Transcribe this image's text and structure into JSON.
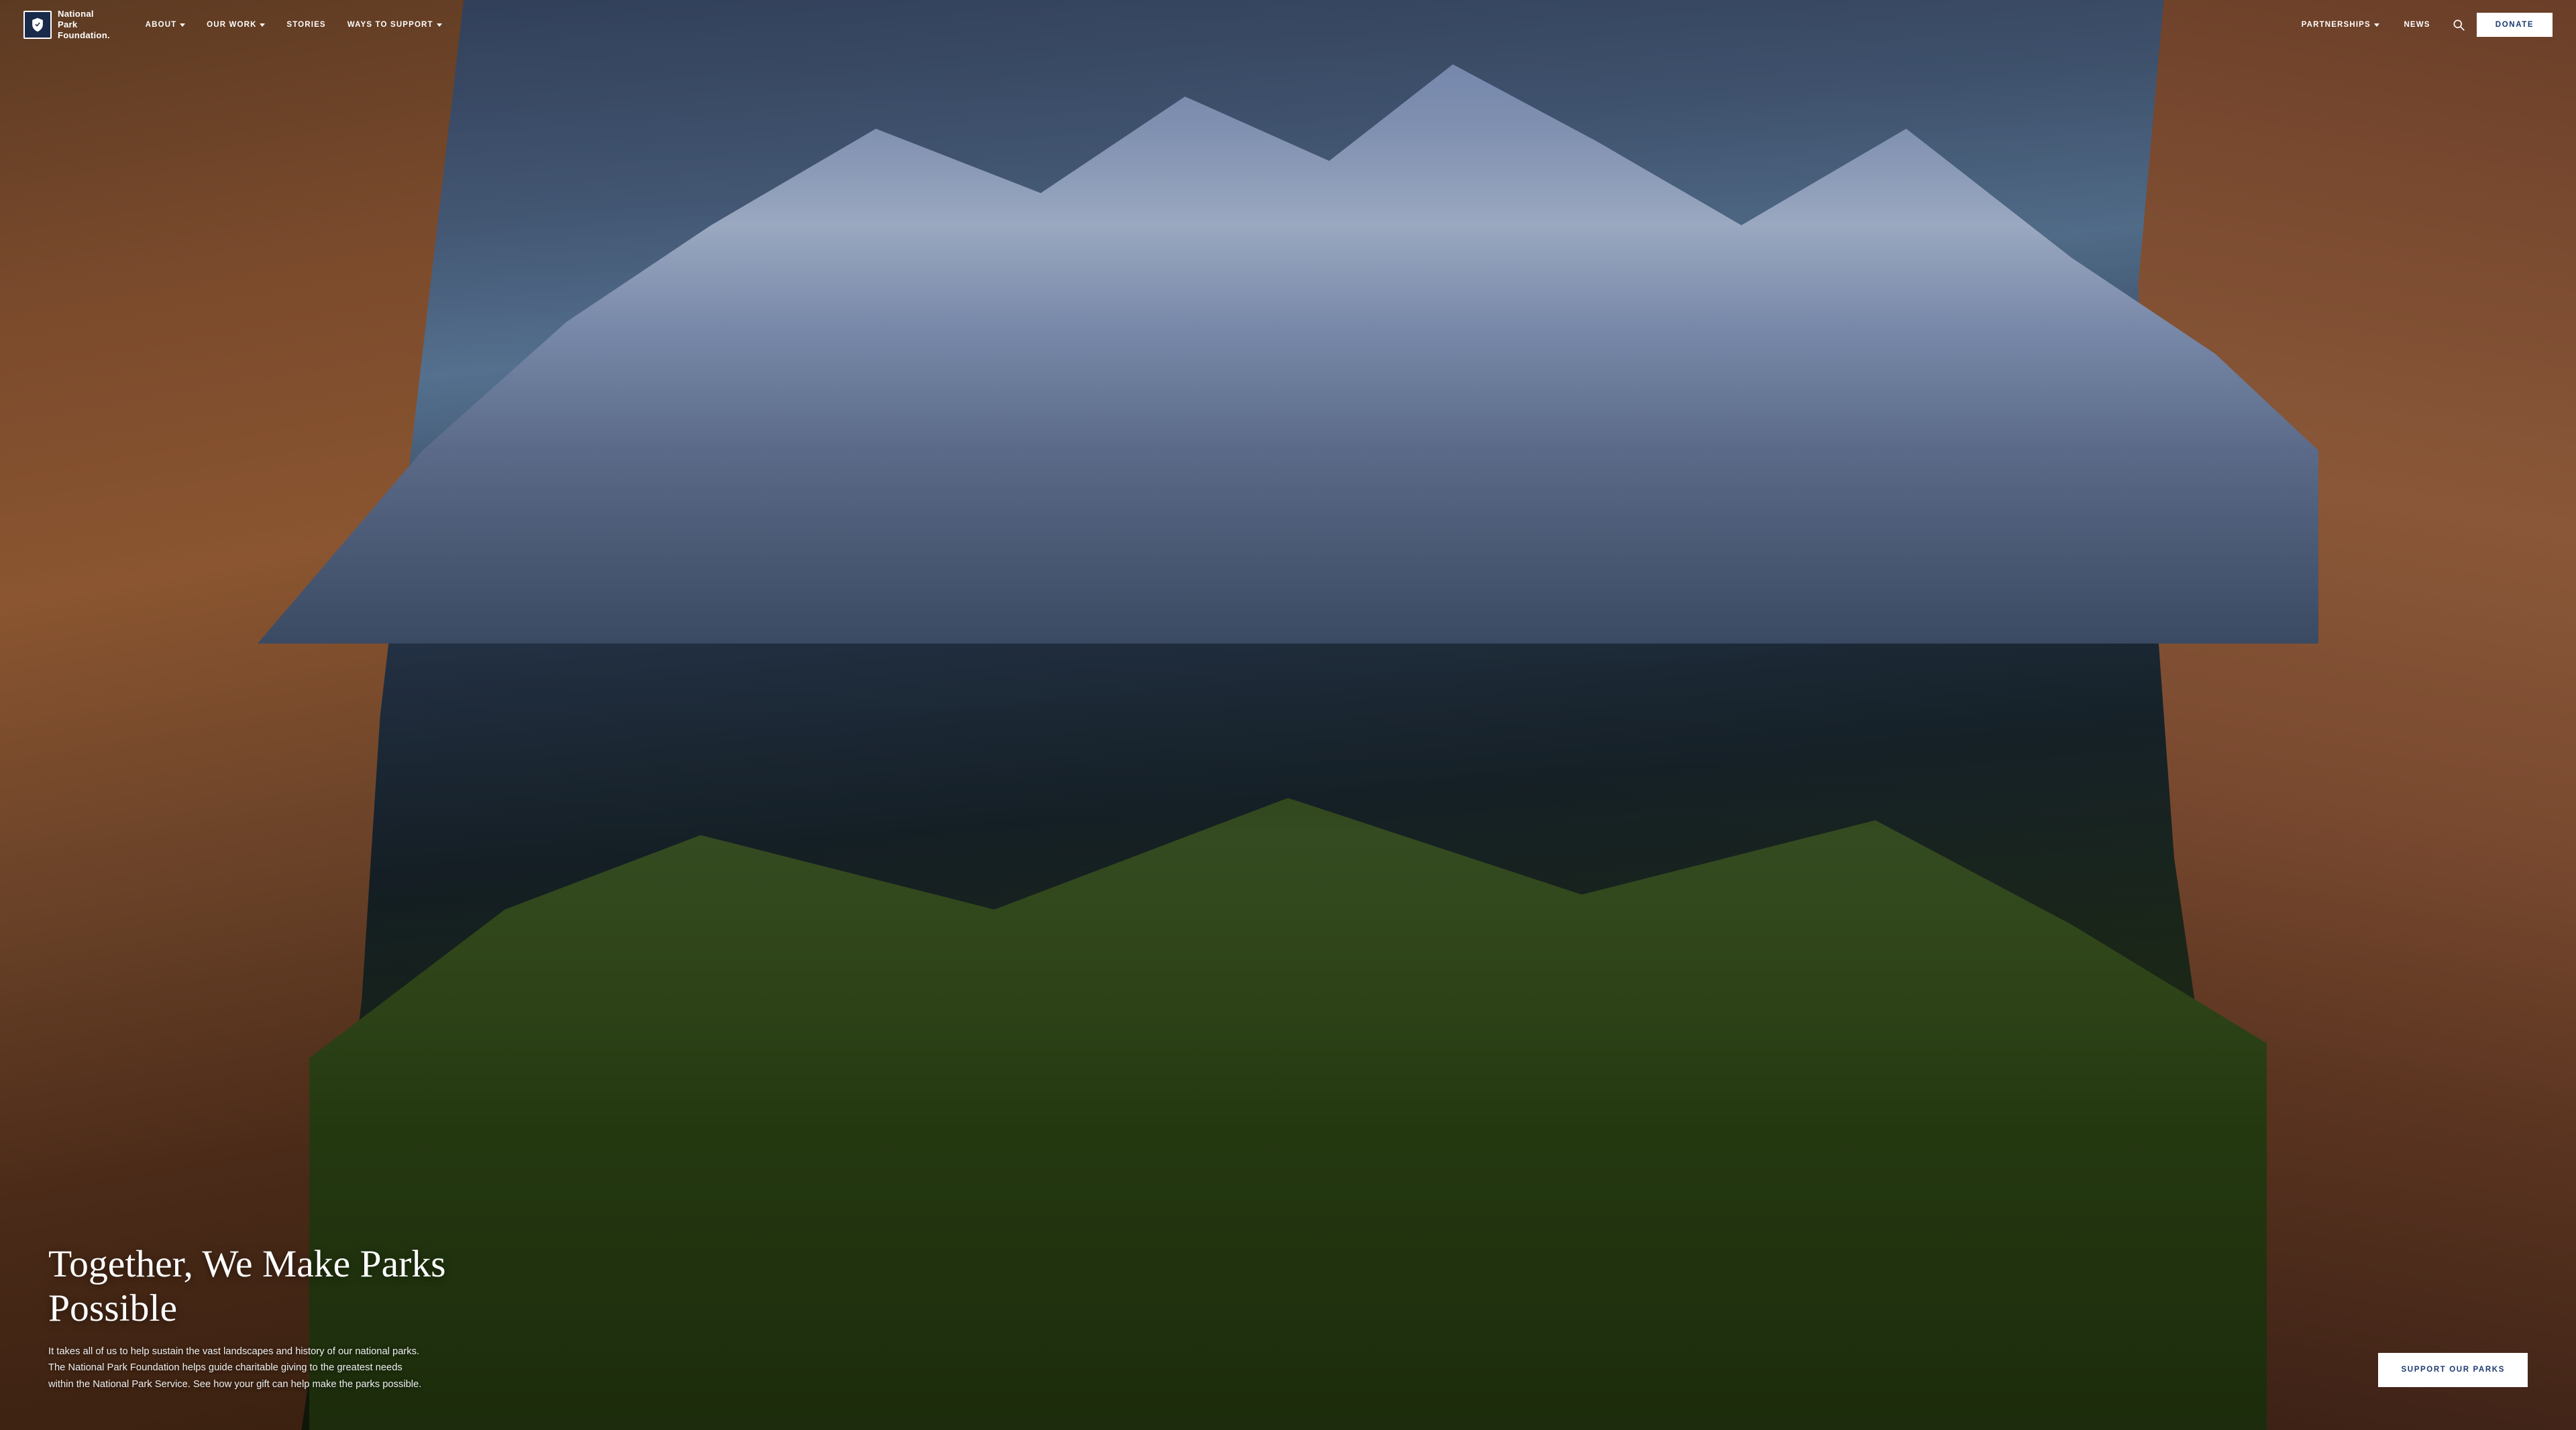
{
  "logo": {
    "line1": "National",
    "line2": "Park",
    "line3": "Foundation."
  },
  "nav": {
    "items": [
      {
        "label": "ABOUT",
        "hasDropdown": true
      },
      {
        "label": "OUR WORK",
        "hasDropdown": true
      },
      {
        "label": "STORIES",
        "hasDropdown": false
      },
      {
        "label": "WAYS TO SUPPORT",
        "hasDropdown": true
      }
    ],
    "rightItems": [
      {
        "label": "PARTNERSHIPS",
        "hasDropdown": true
      },
      {
        "label": "NEWS",
        "hasDropdown": false
      }
    ]
  },
  "donate_label": "DONATE",
  "hero": {
    "headline": "Together, We Make Parks Possible",
    "subtext": "It takes all of us to help sustain the vast landscapes and history of our national parks. The National Park Foundation helps guide charitable giving to the greatest needs within the National Park Service. See how your gift can help make the parks possible.",
    "cta_label": "SUPPORT OUR PARKS"
  }
}
